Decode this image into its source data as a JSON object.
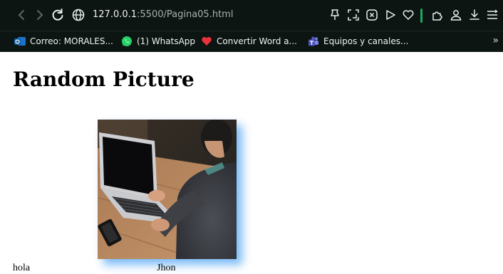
{
  "browser": {
    "url_host": "127.0.0.1",
    "url_rest": ":5500/Pagina05.html"
  },
  "bookmarks": {
    "items": [
      {
        "label": "Correo: MORALES...",
        "icon": "outlook-icon"
      },
      {
        "label": "(1) WhatsApp",
        "icon": "whatsapp-icon"
      },
      {
        "label": "Convertir Word a...",
        "icon": "heart-icon"
      },
      {
        "label": "Equipos y canales...",
        "icon": "teams-icon"
      }
    ],
    "more": "»"
  },
  "page": {
    "title": "Random Picture",
    "image_alt": "person using a laptop",
    "captions": [
      "hola",
      "Jhon"
    ]
  },
  "colors": {
    "topbar_bg": "#0c1512",
    "image_shadow": "#64aff5"
  }
}
